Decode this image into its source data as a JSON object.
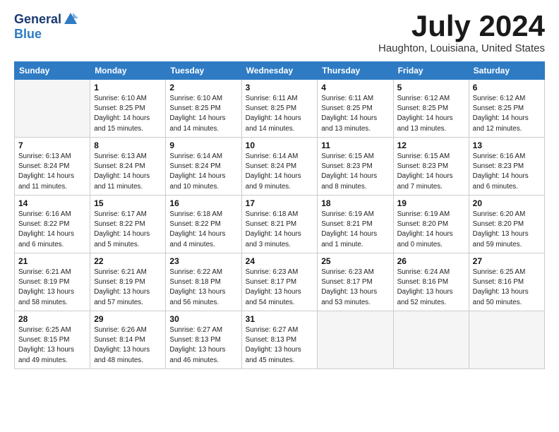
{
  "logo": {
    "general": "General",
    "blue": "Blue"
  },
  "header": {
    "month": "July 2024",
    "location": "Haughton, Louisiana, United States"
  },
  "weekdays": [
    "Sunday",
    "Monday",
    "Tuesday",
    "Wednesday",
    "Thursday",
    "Friday",
    "Saturday"
  ],
  "weeks": [
    [
      {
        "day": null
      },
      {
        "day": 1,
        "sunrise": "6:10 AM",
        "sunset": "8:25 PM",
        "daylight": "14 hours and 15 minutes."
      },
      {
        "day": 2,
        "sunrise": "6:10 AM",
        "sunset": "8:25 PM",
        "daylight": "14 hours and 14 minutes."
      },
      {
        "day": 3,
        "sunrise": "6:11 AM",
        "sunset": "8:25 PM",
        "daylight": "14 hours and 14 minutes."
      },
      {
        "day": 4,
        "sunrise": "6:11 AM",
        "sunset": "8:25 PM",
        "daylight": "14 hours and 13 minutes."
      },
      {
        "day": 5,
        "sunrise": "6:12 AM",
        "sunset": "8:25 PM",
        "daylight": "14 hours and 13 minutes."
      },
      {
        "day": 6,
        "sunrise": "6:12 AM",
        "sunset": "8:25 PM",
        "daylight": "14 hours and 12 minutes."
      }
    ],
    [
      {
        "day": 7,
        "sunrise": "6:13 AM",
        "sunset": "8:24 PM",
        "daylight": "14 hours and 11 minutes."
      },
      {
        "day": 8,
        "sunrise": "6:13 AM",
        "sunset": "8:24 PM",
        "daylight": "14 hours and 11 minutes."
      },
      {
        "day": 9,
        "sunrise": "6:14 AM",
        "sunset": "8:24 PM",
        "daylight": "14 hours and 10 minutes."
      },
      {
        "day": 10,
        "sunrise": "6:14 AM",
        "sunset": "8:24 PM",
        "daylight": "14 hours and 9 minutes."
      },
      {
        "day": 11,
        "sunrise": "6:15 AM",
        "sunset": "8:23 PM",
        "daylight": "14 hours and 8 minutes."
      },
      {
        "day": 12,
        "sunrise": "6:15 AM",
        "sunset": "8:23 PM",
        "daylight": "14 hours and 7 minutes."
      },
      {
        "day": 13,
        "sunrise": "6:16 AM",
        "sunset": "8:23 PM",
        "daylight": "14 hours and 6 minutes."
      }
    ],
    [
      {
        "day": 14,
        "sunrise": "6:16 AM",
        "sunset": "8:22 PM",
        "daylight": "14 hours and 6 minutes."
      },
      {
        "day": 15,
        "sunrise": "6:17 AM",
        "sunset": "8:22 PM",
        "daylight": "14 hours and 5 minutes."
      },
      {
        "day": 16,
        "sunrise": "6:18 AM",
        "sunset": "8:22 PM",
        "daylight": "14 hours and 4 minutes."
      },
      {
        "day": 17,
        "sunrise": "6:18 AM",
        "sunset": "8:21 PM",
        "daylight": "14 hours and 3 minutes."
      },
      {
        "day": 18,
        "sunrise": "6:19 AM",
        "sunset": "8:21 PM",
        "daylight": "14 hours and 1 minute."
      },
      {
        "day": 19,
        "sunrise": "6:19 AM",
        "sunset": "8:20 PM",
        "daylight": "14 hours and 0 minutes."
      },
      {
        "day": 20,
        "sunrise": "6:20 AM",
        "sunset": "8:20 PM",
        "daylight": "13 hours and 59 minutes."
      }
    ],
    [
      {
        "day": 21,
        "sunrise": "6:21 AM",
        "sunset": "8:19 PM",
        "daylight": "13 hours and 58 minutes."
      },
      {
        "day": 22,
        "sunrise": "6:21 AM",
        "sunset": "8:19 PM",
        "daylight": "13 hours and 57 minutes."
      },
      {
        "day": 23,
        "sunrise": "6:22 AM",
        "sunset": "8:18 PM",
        "daylight": "13 hours and 56 minutes."
      },
      {
        "day": 24,
        "sunrise": "6:23 AM",
        "sunset": "8:17 PM",
        "daylight": "13 hours and 54 minutes."
      },
      {
        "day": 25,
        "sunrise": "6:23 AM",
        "sunset": "8:17 PM",
        "daylight": "13 hours and 53 minutes."
      },
      {
        "day": 26,
        "sunrise": "6:24 AM",
        "sunset": "8:16 PM",
        "daylight": "13 hours and 52 minutes."
      },
      {
        "day": 27,
        "sunrise": "6:25 AM",
        "sunset": "8:16 PM",
        "daylight": "13 hours and 50 minutes."
      }
    ],
    [
      {
        "day": 28,
        "sunrise": "6:25 AM",
        "sunset": "8:15 PM",
        "daylight": "13 hours and 49 minutes."
      },
      {
        "day": 29,
        "sunrise": "6:26 AM",
        "sunset": "8:14 PM",
        "daylight": "13 hours and 48 minutes."
      },
      {
        "day": 30,
        "sunrise": "6:27 AM",
        "sunset": "8:13 PM",
        "daylight": "13 hours and 46 minutes."
      },
      {
        "day": 31,
        "sunrise": "6:27 AM",
        "sunset": "8:13 PM",
        "daylight": "13 hours and 45 minutes."
      },
      {
        "day": null
      },
      {
        "day": null
      },
      {
        "day": null
      }
    ]
  ],
  "labels": {
    "sunrise": "Sunrise:",
    "sunset": "Sunset:",
    "daylight": "Daylight:"
  }
}
